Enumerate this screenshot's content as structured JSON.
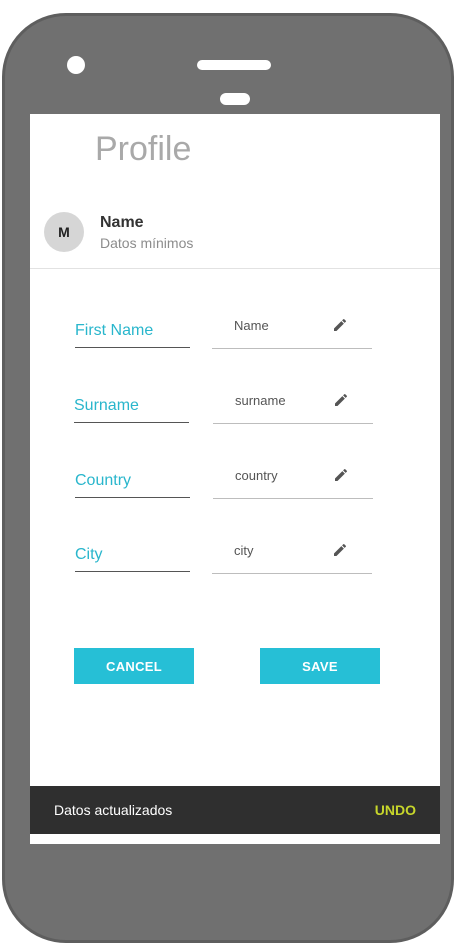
{
  "header": {
    "title": "Profile"
  },
  "profile": {
    "avatar_initial": "M",
    "name": "Name",
    "subtitle": "Datos mínimos"
  },
  "fields": [
    {
      "label": "First Name",
      "value": "Name",
      "icon": "pencil-icon"
    },
    {
      "label": "Surname",
      "value": "surname",
      "icon": "pencil-icon"
    },
    {
      "label": "Country",
      "value": "country",
      "icon": "pencil-icon"
    },
    {
      "label": "City",
      "value": "city",
      "icon": "pencil-icon"
    }
  ],
  "actions": {
    "cancel_label": "CANCEL",
    "save_label": "SAVE"
  },
  "snackbar": {
    "message": "Datos actualizados",
    "action_label": "UNDO"
  },
  "colors": {
    "accent": "#26bfd6",
    "snackbar_bg": "#2f2f2f",
    "snackbar_action": "#c7d62b",
    "phone_frame": "#707070"
  }
}
